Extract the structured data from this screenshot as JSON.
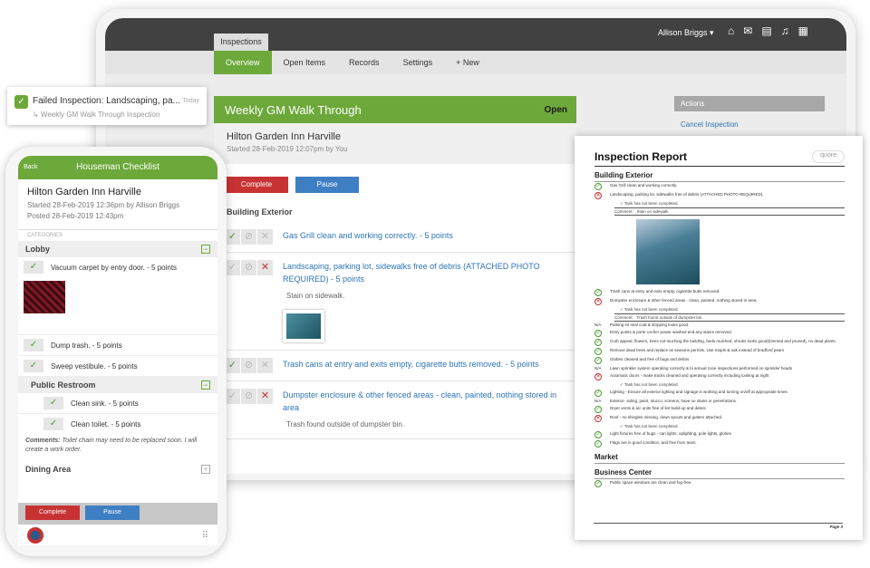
{
  "colors": {
    "green": "#6da83a",
    "red": "#c83232",
    "blue": "#3e7fc4",
    "link": "#2e74b5"
  },
  "web": {
    "top_tab": "Inspections",
    "user": "Allison Briggs ▾",
    "icons": [
      "home-icon",
      "mail-icon",
      "chat-icon",
      "bell-icon",
      "grid-icon"
    ],
    "nav": [
      "Overview",
      "Open Items",
      "Records",
      "Settings",
      "+ New"
    ],
    "title": "Weekly GM Walk Through",
    "status": "Open",
    "location": "Hilton Garden Inn Harville",
    "started": "Started 28-Feb-2019 12:07pm by You",
    "complete": "Complete",
    "pause": "Pause",
    "section": "Building Exterior",
    "items": [
      {
        "text": "Gas Grill clean and working correctly. - 5 points"
      },
      {
        "text": "Landscaping, parking lot, sidewalks free of debris (ATTACHED PHOTO REQUIRED) - 5 points",
        "comment": "Stain on sidewalk."
      },
      {
        "text": "Trash cans at entry and exits empty, cigarette butts removed. - 5 points"
      },
      {
        "text": "Dumpster enclosure & other fenced areas - clean, painted, nothing stored in area",
        "comment": "Trash found outside of dumpster bin."
      }
    ],
    "actions_header": "Actions",
    "cancel": "Cancel Inspection"
  },
  "notification": {
    "title": "Failed Inspection: Landscaping, pa...",
    "time": "Today",
    "sub": "↳ Weekly GM Walk Through Inspection"
  },
  "phone": {
    "back": "Back",
    "title": "Houseman Checklist",
    "location": "Hilton Garden Inn Harville",
    "started": "Started 28-Feb-2019 12:36pm by Allison Briggs",
    "posted": "Posted 28-Feb-2019 12:43pm",
    "categories": "CATEGORIES",
    "lobby": "Lobby",
    "vacuum": "Vacuum carpet by entry door. - 5 points",
    "dump": "Dump trash. - 5 points",
    "sweep": "Sweep vestibule. - 5 points",
    "restroom": "Public Restroom",
    "sink": "Clean sink. - 5 points",
    "toilet": "Clean toilet. - 5 points",
    "comment_label": "Comments:",
    "comment": " Toilet chain may need to be replaced soon. I will create a work order.",
    "dining": "Dining Area",
    "complete": "Complete",
    "pause": "Pause"
  },
  "report": {
    "title": "Inspection Report",
    "logo": "quore",
    "s1": "Building Exterior",
    "rows_a": [
      {
        "k": "g",
        "t": "Gas Grill clean and working correctly."
      },
      {
        "k": "r",
        "t": "Landscaping, parking lot, sidewalks free of debris (ATTACHED PHOTO REQUIRED)."
      }
    ],
    "not_completed": "✓ Task has not been completed.",
    "comment_label": "Comment:",
    "comment1": "Stain on sidewalk.",
    "rows_b": [
      {
        "k": "g",
        "t": "Trash cans at entry and exits empty, cigarette butts removed."
      },
      {
        "k": "r",
        "t": "Dumpster enclosure & other fenced areas - clean, painted, nothing stored in area."
      }
    ],
    "comment2": "Trash found outside of dumpster bin.",
    "rows_c": [
      {
        "k": "n",
        "t": "Parking lot seal coat & stripping looks good."
      },
      {
        "k": "g",
        "t": "Entry points & porte cocher power washed and any stains removed."
      },
      {
        "k": "g",
        "t": "Curb appeal, flowers, trees not touching the building, beds mulched, shrubs looks good(trimmed and pruned), no dead plants."
      },
      {
        "k": "g",
        "t": "Remove dead trees and replace as seasons permits. Use maple & oak instead of bradford pears"
      },
      {
        "k": "g",
        "t": "Globes cleaned and free of bugs and debris"
      },
      {
        "k": "n",
        "t": "Lawn sprinkler system operating correctly & bi annual zone inspections performed on sprinkler heads"
      },
      {
        "k": "r",
        "t": "Automatic doors - make tracks cleaned and operating correctly including looking at night"
      }
    ],
    "rows_d": [
      {
        "k": "g",
        "t": "Lighting - Ensure all exterior lighting and signage is working and turning on/off at appropriate times"
      },
      {
        "k": "n",
        "t": "Exterior- siding, paint, stucco, screens, have no stains or penetrations."
      },
      {
        "k": "g",
        "t": "Dryer vents & a/c units free of lint build-up and debris"
      },
      {
        "k": "r",
        "t": "Roof - no shingles missing, down spouts and gutters attached."
      }
    ],
    "rows_e": [
      {
        "k": "g",
        "t": "Light fixtures free of bugs - can lights, uplighting, pole lights, globes"
      },
      {
        "k": "g",
        "t": "Flags are in good condition, and free from tears."
      }
    ],
    "s2": "Market",
    "s3": "Business Center",
    "rows_f": [
      {
        "k": "g",
        "t": "Public space windows are clean and fog-free."
      }
    ],
    "page": "Page 3"
  }
}
